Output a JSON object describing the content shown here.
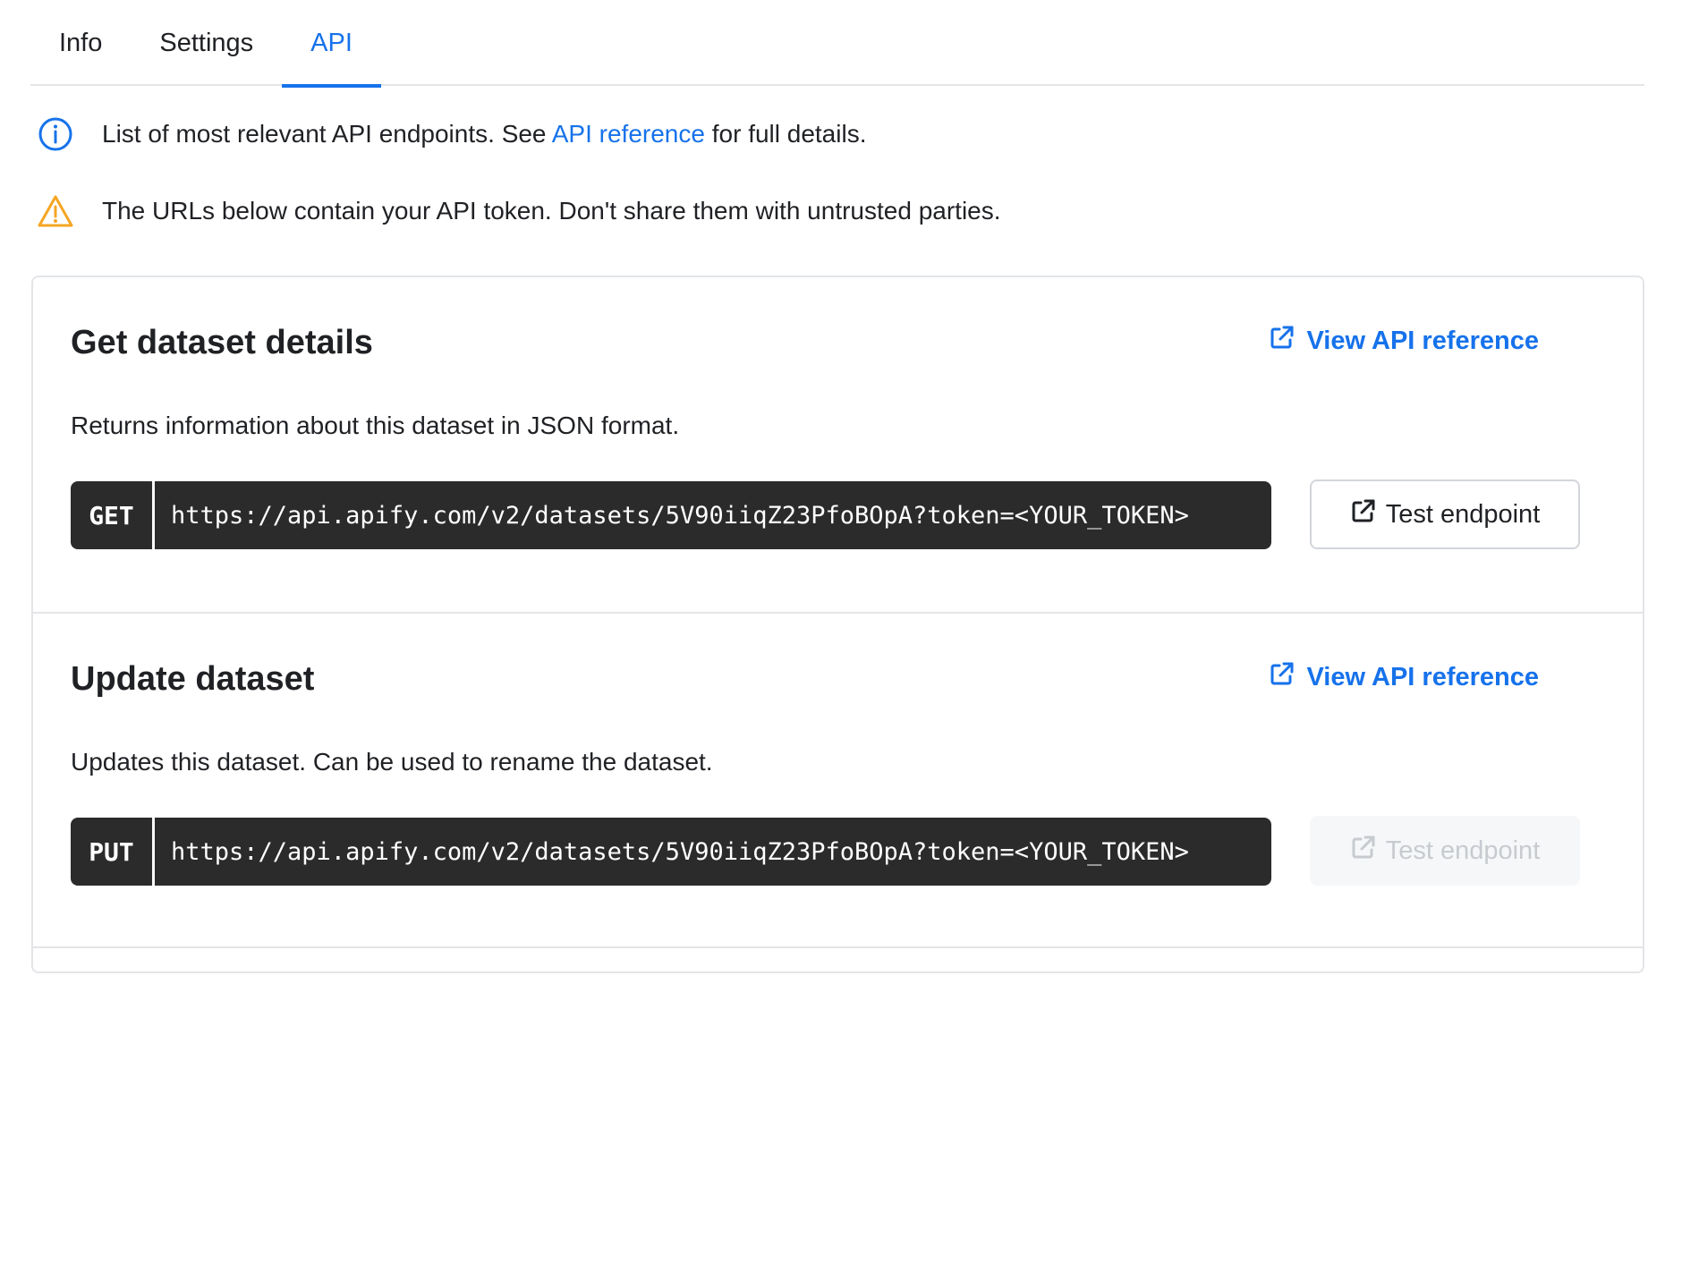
{
  "tabs": [
    {
      "label": "Info",
      "active": false
    },
    {
      "label": "Settings",
      "active": false
    },
    {
      "label": "API",
      "active": true
    }
  ],
  "notices": {
    "info": {
      "icon": "info-circle-icon",
      "text_before": "List of most relevant API endpoints. See ",
      "link_text": "API reference",
      "text_after": " for full details."
    },
    "warning": {
      "icon": "warning-triangle-icon",
      "text": "The URLs below contain your API token. Don't share them with untrusted parties."
    }
  },
  "sections": [
    {
      "title": "Get dataset details",
      "api_ref_label": "View API reference",
      "description": "Returns information about this dataset in JSON format.",
      "method": "GET",
      "url": "https://api.apify.com/v2/datasets/5V90iiqZ23PfoBOpA?token=<YOUR_TOKEN>",
      "test_label": "Test endpoint",
      "test_enabled": true
    },
    {
      "title": "Update dataset",
      "api_ref_label": "View API reference",
      "description": "Updates this dataset. Can be used to rename the dataset.",
      "method": "PUT",
      "url": "https://api.apify.com/v2/datasets/5V90iiqZ23PfoBOpA?token=<YOUR_TOKEN>",
      "test_label": "Test endpoint",
      "test_enabled": false
    }
  ],
  "colors": {
    "accent": "#1672eb",
    "warning": "#f5a623",
    "code_bg": "#2b2b2b",
    "border": "#e3e5e8"
  }
}
